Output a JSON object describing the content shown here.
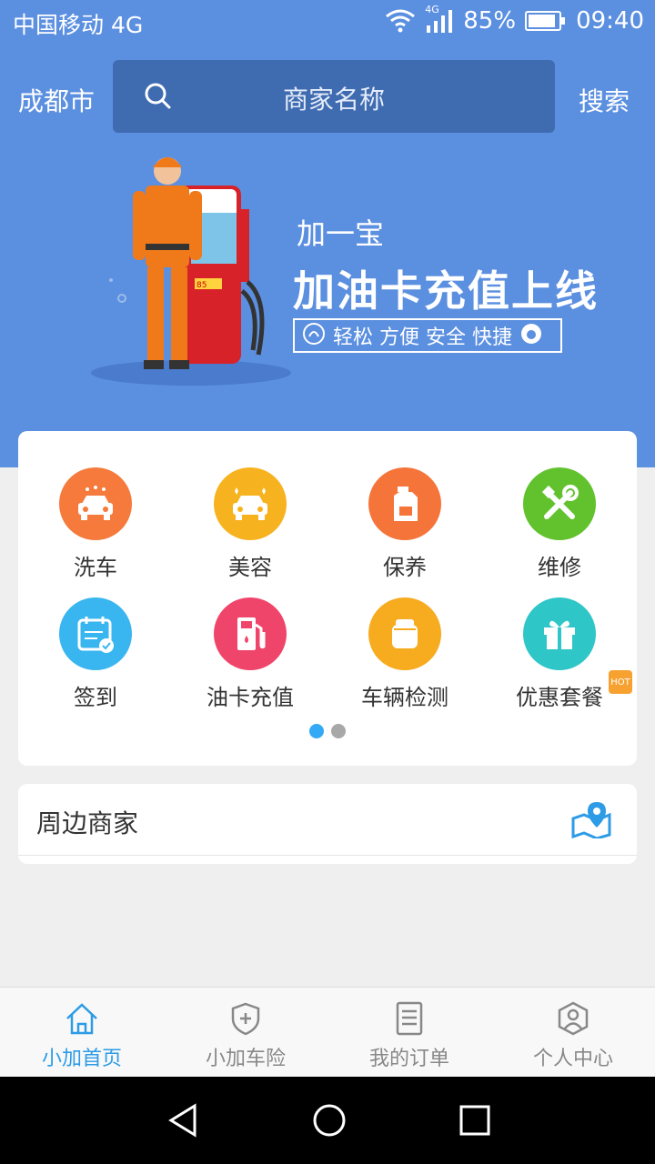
{
  "status_bar": {
    "carrier": "中国移动 4G",
    "network_badge": "4G",
    "battery": "85%",
    "time": "09:40"
  },
  "header": {
    "city": "成都市",
    "search_placeholder": "商家名称",
    "search_button": "搜索"
  },
  "banner": {
    "subtitle": "加一宝",
    "title": "加油卡充值上线",
    "tagline": "轻松 方便 安全 快捷",
    "pump_display": "85"
  },
  "services": [
    {
      "label": "洗车",
      "icon": "car-wash-icon",
      "color": "#f57a3c"
    },
    {
      "label": "美容",
      "icon": "car-beauty-icon",
      "color": "#f7b21f"
    },
    {
      "label": "保养",
      "icon": "oil-bottle-icon",
      "color": "#f5743a"
    },
    {
      "label": "维修",
      "icon": "repair-tools-icon",
      "color": "#62c22e"
    },
    {
      "label": "签到",
      "icon": "calendar-check-icon",
      "color": "#39b6f0"
    },
    {
      "label": "油卡充值",
      "icon": "fuel-pump-icon",
      "color": "#f0456a"
    },
    {
      "label": "车辆检测",
      "icon": "inspection-icon",
      "color": "#f7ab1e"
    },
    {
      "label": "优惠套餐",
      "icon": "gift-icon",
      "color": "#2fc6c8",
      "badge": "HOT"
    }
  ],
  "pager": {
    "pages": 2,
    "active": 1
  },
  "nearby": {
    "title": "周边商家",
    "icon": "map-location-icon"
  },
  "tabs": [
    {
      "label": "小加首页",
      "icon": "home-icon",
      "active": true
    },
    {
      "label": "小加车险",
      "icon": "shield-plus-icon",
      "active": false
    },
    {
      "label": "我的订单",
      "icon": "order-list-icon",
      "active": false
    },
    {
      "label": "个人中心",
      "icon": "user-icon",
      "active": false
    }
  ],
  "colors": {
    "primary": "#5b8fe0",
    "search_bg": "#3f6bb0",
    "active_tab": "#2d9be6",
    "inactive_tab": "#888888"
  }
}
